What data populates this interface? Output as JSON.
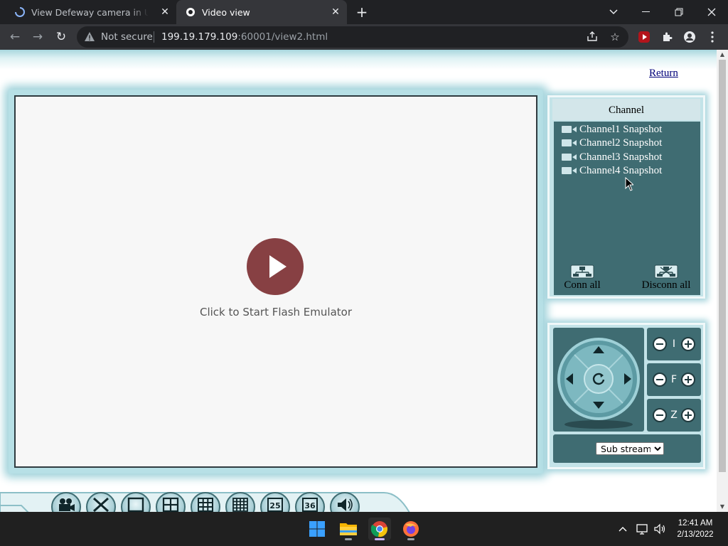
{
  "browser": {
    "tabs": [
      {
        "title": "View Defeway camera in United St"
      },
      {
        "title": "Video view"
      }
    ],
    "security_label": "Not secure",
    "url_host": "199.19.179.109",
    "url_rest": ":60001/view2.html"
  },
  "page": {
    "return_link": "Return",
    "player": {
      "caption": "Click to Start Flash Emulator"
    },
    "channel_panel": {
      "title": "Channel",
      "items": [
        {
          "label": "Channel1 Snapshot"
        },
        {
          "label": "Channel2 Snapshot"
        },
        {
          "label": "Channel3 Snapshot"
        },
        {
          "label": "Channel4 Snapshot"
        }
      ],
      "conn_all": "Conn all",
      "disconn_all": "Disconn all"
    },
    "ptz": {
      "rows": [
        {
          "label": "I"
        },
        {
          "label": "F"
        },
        {
          "label": "Z"
        }
      ],
      "stream_options": [
        "Sub stream"
      ],
      "stream_selected": "Sub stream"
    },
    "bottom_toolbar": {
      "buttons": [
        {
          "icon": "record-icon"
        },
        {
          "icon": "settings-tools-icon"
        },
        {
          "icon": "single-view-icon"
        },
        {
          "icon": "quad-view-icon"
        },
        {
          "icon": "nine-view-icon"
        },
        {
          "icon": "sixteen-view-icon"
        },
        {
          "icon": "grid-25-icon",
          "label": "25"
        },
        {
          "icon": "grid-36-icon",
          "label": "36"
        },
        {
          "icon": "speaker-icon"
        }
      ]
    }
  },
  "taskbar": {
    "clock_time": "12:41 AM",
    "clock_date": "2/13/2022"
  },
  "colors": {
    "panel_teal": "#3f6c72",
    "play_button": "#874043",
    "glow": "#a5d4dc"
  }
}
